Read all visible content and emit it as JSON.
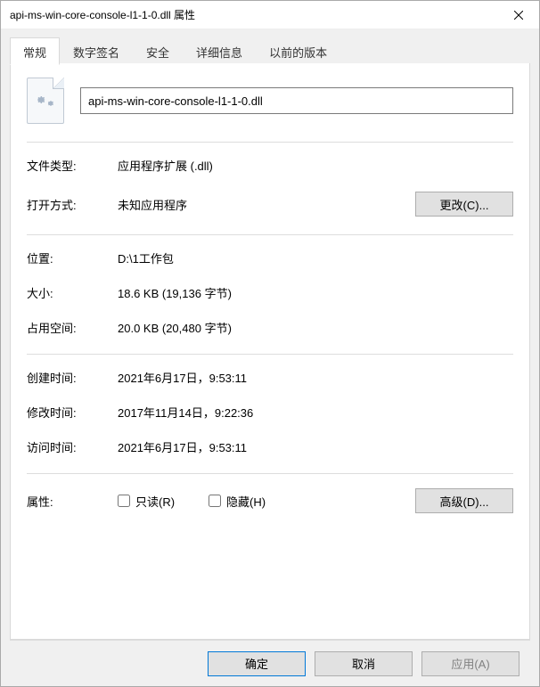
{
  "window": {
    "title": "api-ms-win-core-console-l1-1-0.dll 属性"
  },
  "tabs": {
    "general": "常规",
    "signatures": "数字签名",
    "security": "安全",
    "details": "详细信息",
    "previous": "以前的版本"
  },
  "filename": "api-ms-win-core-console-l1-1-0.dll",
  "labels": {
    "file_type": "文件类型:",
    "open_with": "打开方式:",
    "location": "位置:",
    "size": "大小:",
    "size_on_disk": "占用空间:",
    "created": "创建时间:",
    "modified": "修改时间:",
    "accessed": "访问时间:",
    "attributes": "属性:"
  },
  "values": {
    "file_type": "应用程序扩展 (.dll)",
    "open_with": "未知应用程序",
    "location": "D:\\1工作包",
    "size": "18.6 KB (19,136 字节)",
    "size_on_disk": "20.0 KB (20,480 字节)",
    "created": "2021年6月17日，9:53:11",
    "modified": "2017年11月14日，9:22:36",
    "accessed": "2021年6月17日，9:53:11"
  },
  "attributes": {
    "readonly": "只读(R)",
    "hidden": "隐藏(H)"
  },
  "buttons": {
    "change": "更改(C)...",
    "advanced": "高级(D)...",
    "ok": "确定",
    "cancel": "取消",
    "apply": "应用(A)"
  }
}
